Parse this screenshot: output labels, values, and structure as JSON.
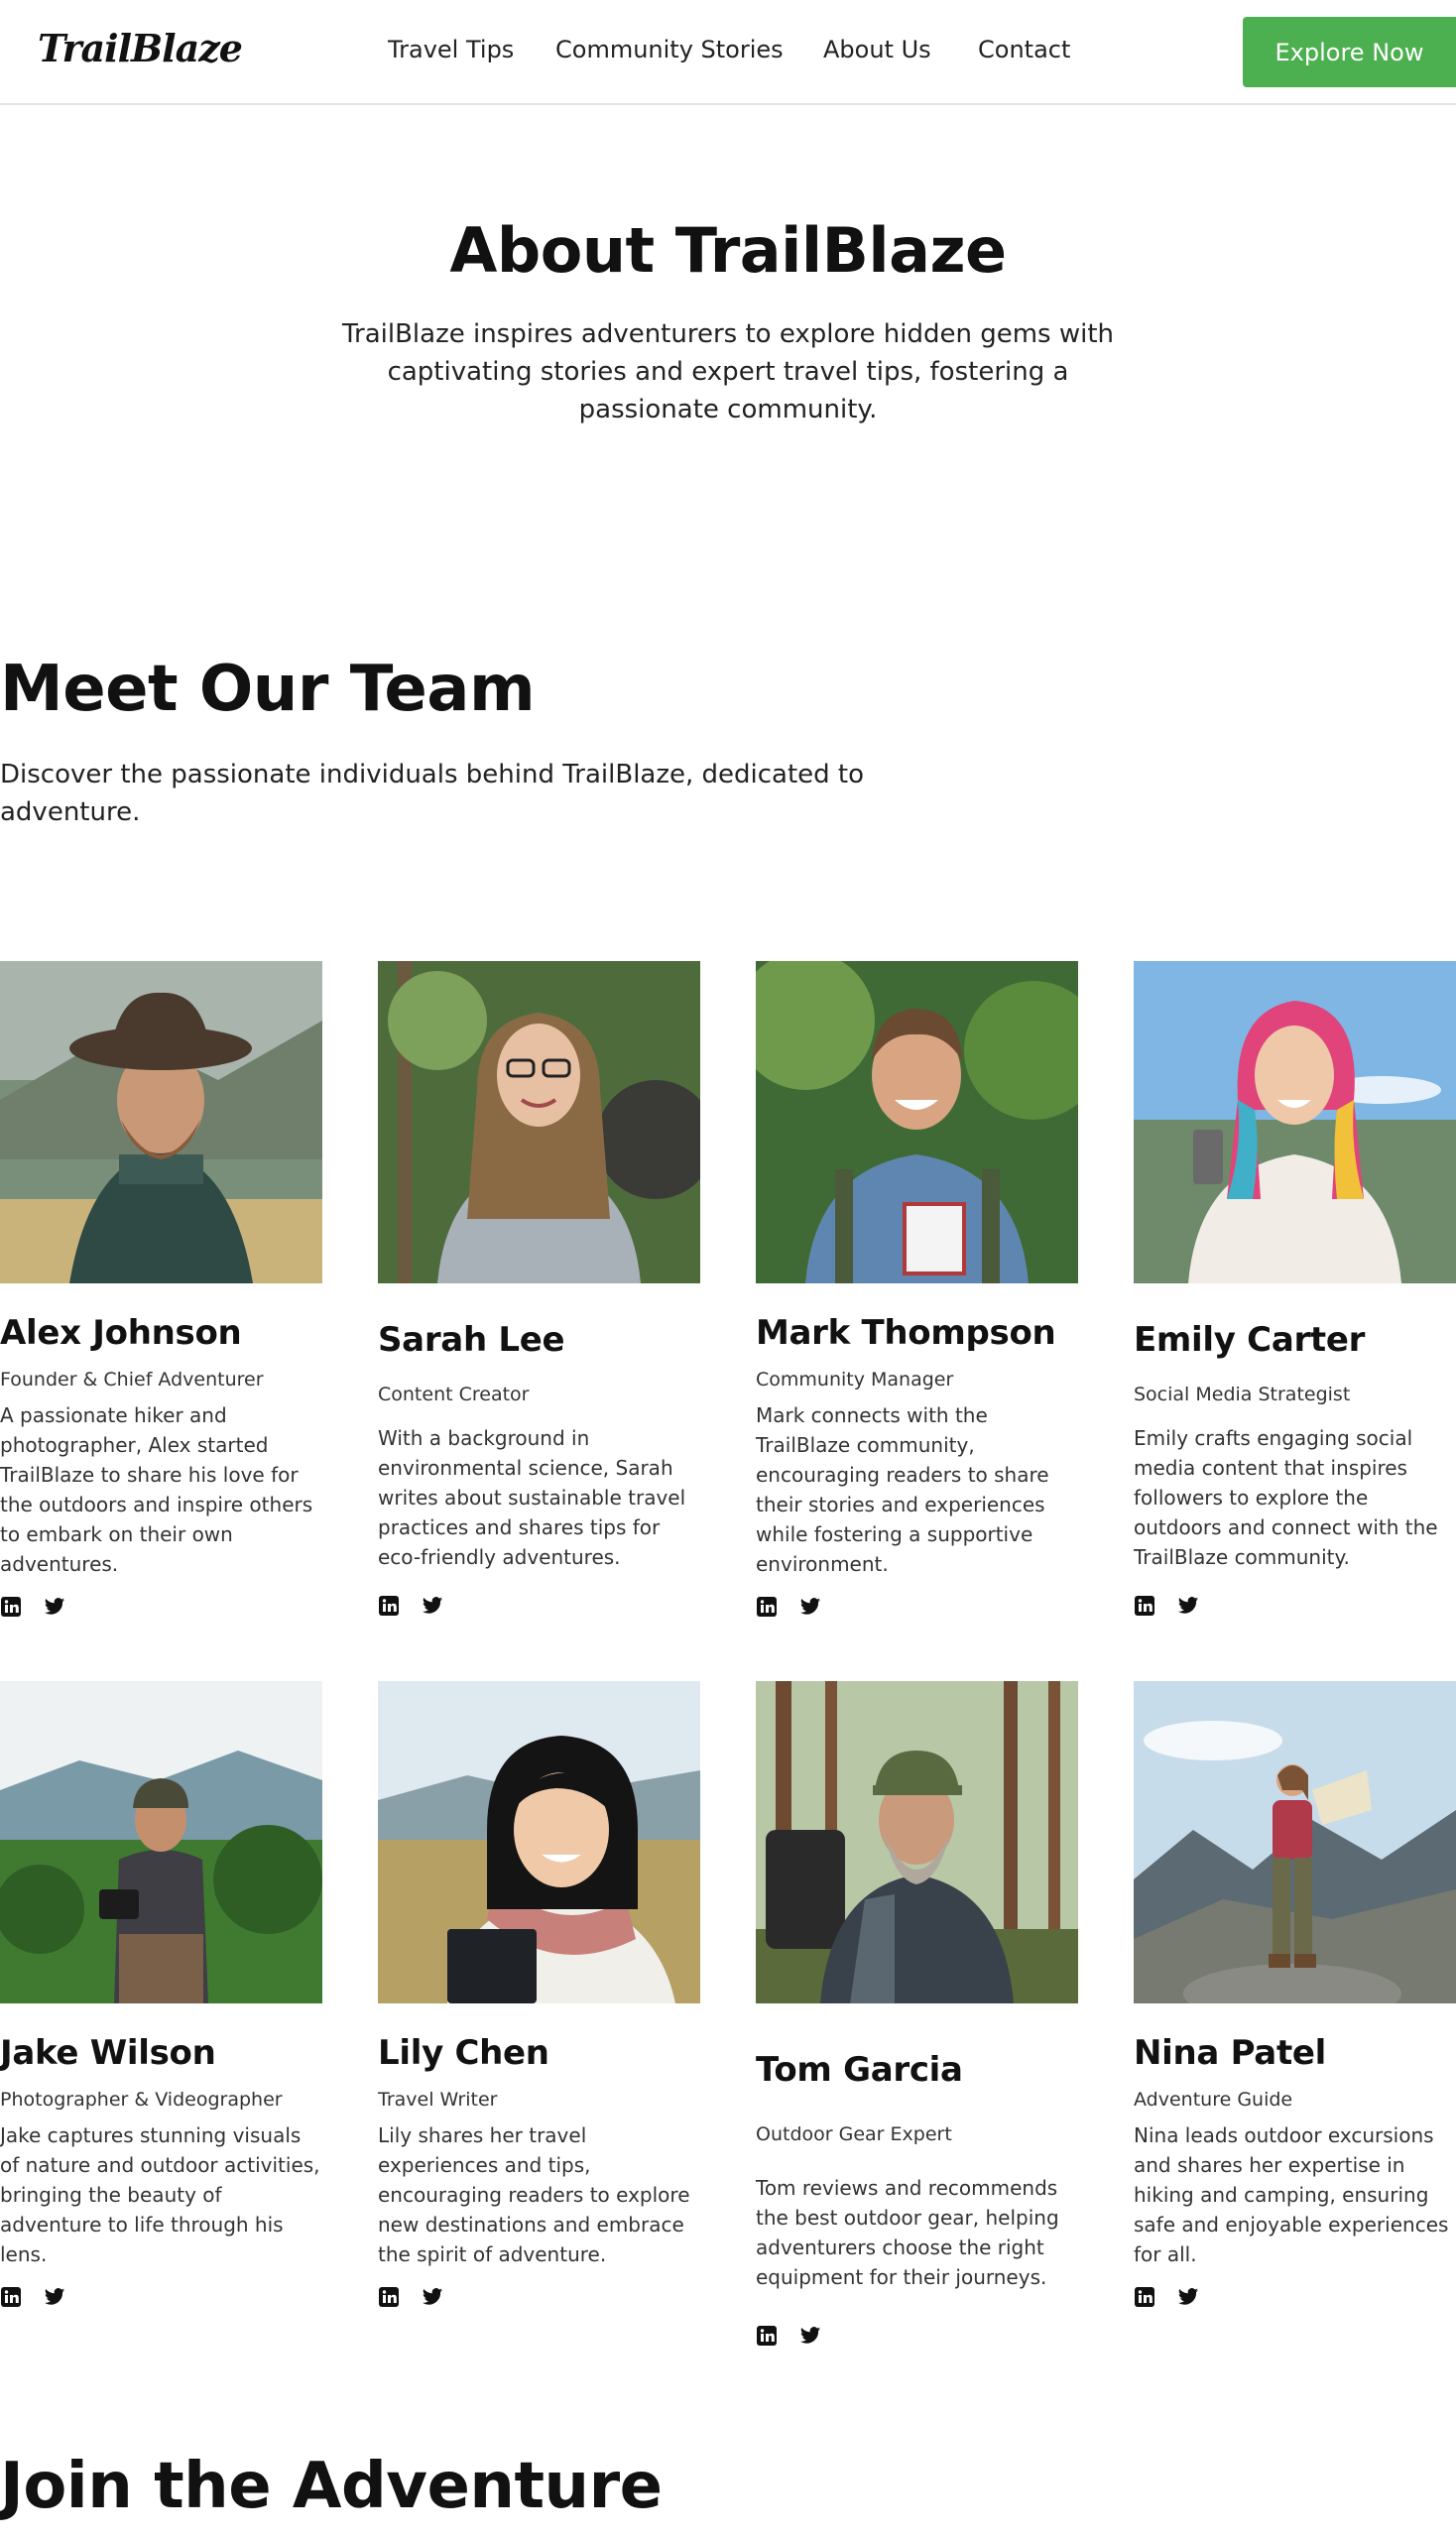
{
  "header": {
    "logo": "TrailBlaze",
    "nav": [
      "Travel Tips",
      "Community Stories",
      "About Us",
      "Contact"
    ],
    "cta": "Explore Now"
  },
  "hero": {
    "title": "About TrailBlaze",
    "description": "TrailBlaze inspires adventurers to explore hidden gems with captivating stories and expert travel tips, fostering a passionate community."
  },
  "team": {
    "title": "Meet Our Team",
    "description": "Discover the passionate individuals behind TrailBlaze, dedicated to adventure.",
    "members": [
      {
        "name": "Alex Johnson",
        "role": "Founder & Chief Adventurer",
        "bio": "A passionate hiker and photographer, Alex started TrailBlaze to share his love for the outdoors and inspire others to embark on their own adventures."
      },
      {
        "name": "Sarah Lee",
        "role": "Content Creator",
        "bio": "With a background in environmental science, Sarah writes about sustainable travel practices and shares tips for eco-friendly adventures."
      },
      {
        "name": "Mark Thompson",
        "role": "Community Manager",
        "bio": "Mark connects with the TrailBlaze community, encouraging readers to share their stories and experiences while fostering a supportive environment."
      },
      {
        "name": "Emily Carter",
        "role": "Social Media Strategist",
        "bio": "Emily crafts engaging social media content that inspires followers to explore the outdoors and connect with the TrailBlaze community."
      },
      {
        "name": "Jake Wilson",
        "role": "Photographer & Videographer",
        "bio": "Jake captures stunning visuals of nature and outdoor activities, bringing the beauty of adventure to life through his lens."
      },
      {
        "name": "Lily Chen",
        "role": "Travel Writer",
        "bio": "Lily shares her travel experiences and tips, encouraging readers to explore new destinations and embrace the spirit of adventure."
      },
      {
        "name": "Tom Garcia",
        "role": "Outdoor Gear Expert",
        "bio": "Tom reviews and recommends the best outdoor gear, helping adventurers choose the right equipment for their journeys."
      },
      {
        "name": "Nina Patel",
        "role": "Adventure Guide",
        "bio": "Nina leads outdoor excursions and shares her expertise in hiking and camping, ensuring safe and enjoyable experiences for all."
      }
    ]
  },
  "join": {
    "title": "Join the Adventure"
  },
  "icons": {
    "social": [
      "linkedin-icon",
      "twitter-icon"
    ]
  },
  "colors": {
    "accent": "#4caf50"
  }
}
